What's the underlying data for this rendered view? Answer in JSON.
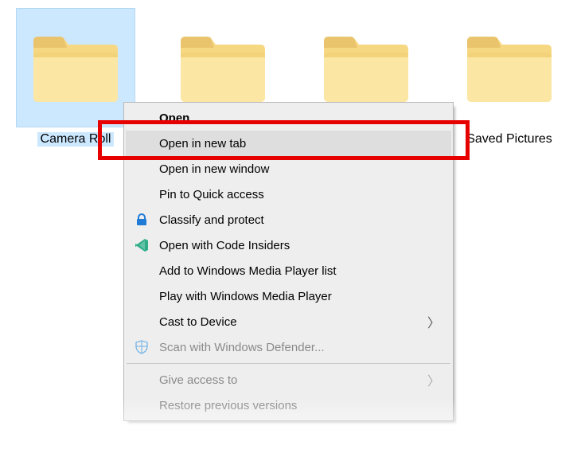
{
  "folders": [
    {
      "label": "Camera Roll",
      "selected": true
    },
    {
      "label": "",
      "selected": false
    },
    {
      "label": "",
      "selected": false
    },
    {
      "label": "Saved Pictures",
      "selected": false
    }
  ],
  "context_menu": {
    "open": "Open",
    "open_new_tab": "Open in new tab",
    "open_new_window": "Open in new window",
    "pin_quick_access": "Pin to Quick access",
    "classify_protect": "Classify and protect",
    "open_code_insiders": "Open with Code Insiders",
    "add_wmp_list": "Add to Windows Media Player list",
    "play_wmp": "Play with Windows Media Player",
    "cast_to_device": "Cast to Device",
    "scan_defender": "Scan with Windows Defender...",
    "give_access_to": "Give access to",
    "restore_previous": "Restore previous versions"
  },
  "colors": {
    "selection": "#cce8ff",
    "menu_bg": "#eeeeee",
    "highlight": "#e60000",
    "folder_fill": "#f7d882",
    "folder_tab": "#eac36d"
  }
}
